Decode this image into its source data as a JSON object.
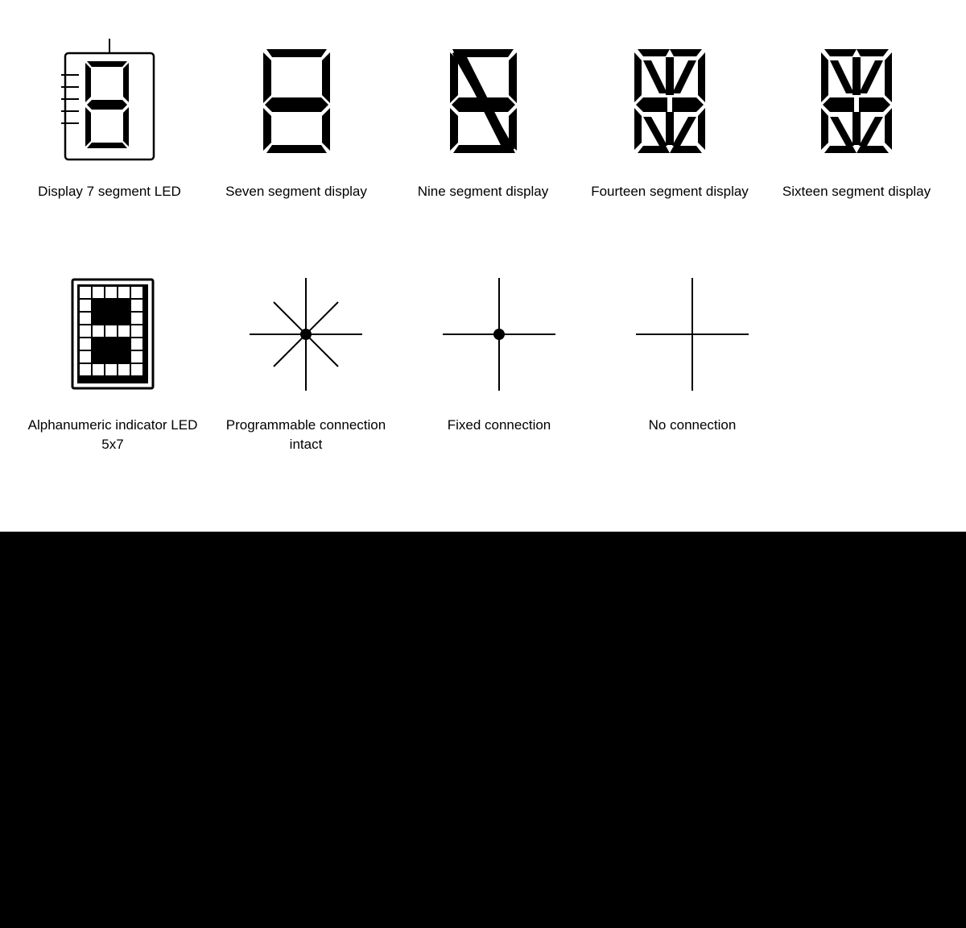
{
  "rows": [
    {
      "id": "row1",
      "items": [
        {
          "id": "display-7seg-led",
          "label": "Display\n7 segment LED",
          "icon_type": "display_7seg_led"
        },
        {
          "id": "seven-segment",
          "label": "Seven segment\ndisplay",
          "icon_type": "seven_segment"
        },
        {
          "id": "nine-segment",
          "label": "Nine segment\ndisplay",
          "icon_type": "nine_segment"
        },
        {
          "id": "fourteen-segment",
          "label": "Fourteen segment\ndisplay",
          "icon_type": "fourteen_segment"
        },
        {
          "id": "sixteen-segment",
          "label": "Sixteen segment\ndisplay",
          "icon_type": "sixteen_segment"
        }
      ]
    },
    {
      "id": "row2",
      "items": [
        {
          "id": "alphanumeric",
          "label": "Alphanumeric\nindicator\nLED 5x7",
          "icon_type": "alphanumeric"
        },
        {
          "id": "programmable-connection",
          "label": "Programmable\nconnection\nintact",
          "icon_type": "programmable_connection"
        },
        {
          "id": "fixed-connection",
          "label": "Fixed\nconnection",
          "icon_type": "fixed_connection"
        },
        {
          "id": "no-connection",
          "label": "No connection",
          "icon_type": "no_connection"
        }
      ]
    }
  ]
}
